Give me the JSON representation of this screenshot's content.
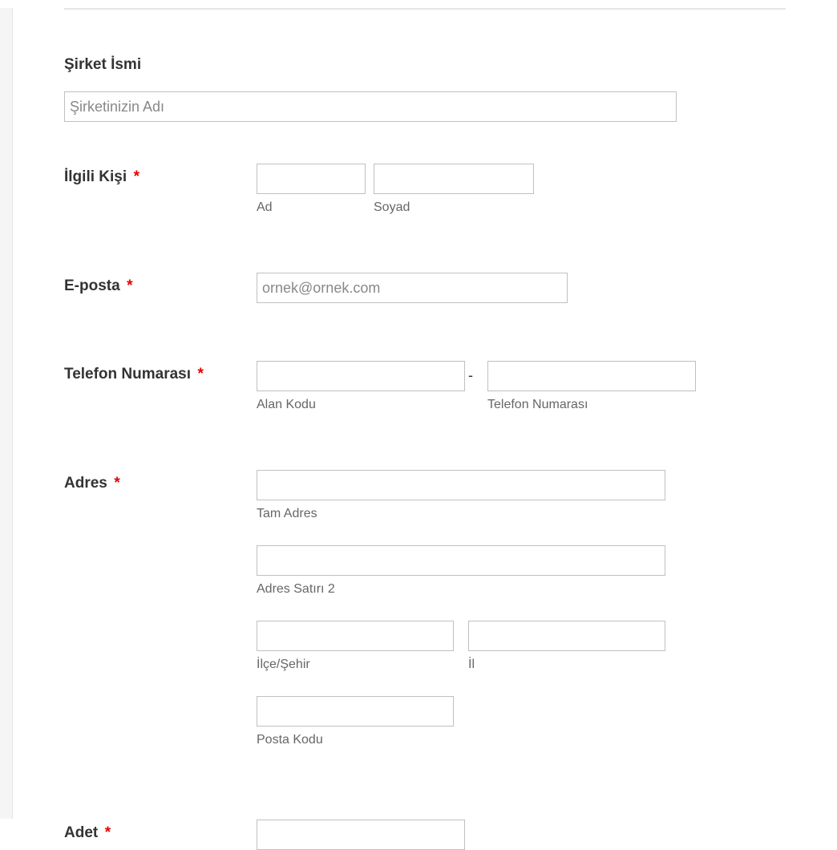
{
  "company": {
    "label": "Şirket İsmi",
    "placeholder": "Şirketinizin Adı"
  },
  "contact": {
    "label": "İlgili Kişi",
    "first_sublabel": "Ad",
    "last_sublabel": "Soyad"
  },
  "email": {
    "label": "E-posta",
    "placeholder": "ornek@ornek.com"
  },
  "phone": {
    "label": "Telefon Numarası",
    "area_sublabel": "Alan Kodu",
    "number_sublabel": "Telefon Numarası",
    "separator": "-"
  },
  "address": {
    "label": "Adres",
    "full_sublabel": "Tam Adres",
    "line2_sublabel": "Adres Satırı 2",
    "city_sublabel": "İlçe/Şehir",
    "state_sublabel": "İl",
    "postal_sublabel": "Posta Kodu"
  },
  "quantity": {
    "label": "Adet"
  },
  "required_marker": "*"
}
